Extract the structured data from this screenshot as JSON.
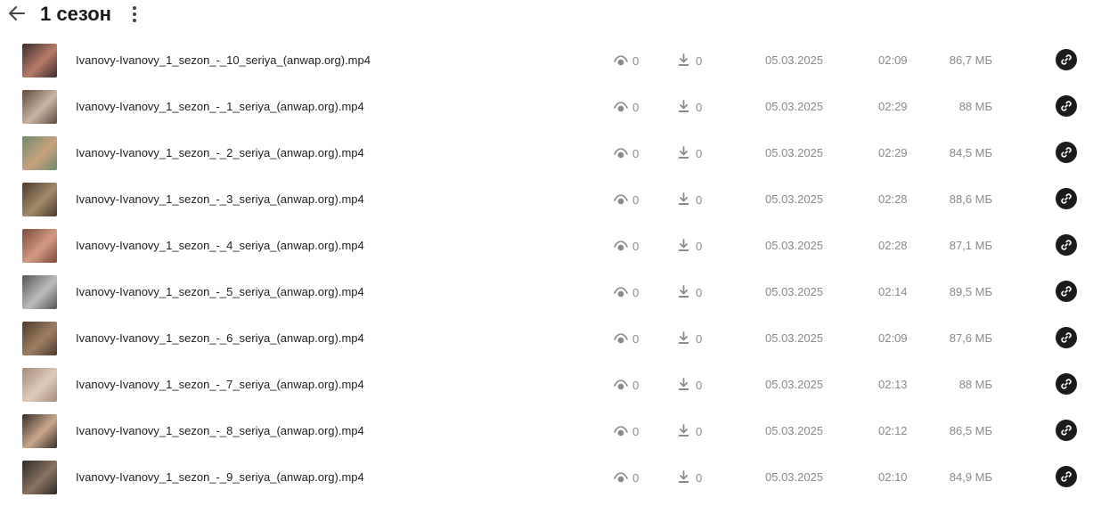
{
  "header": {
    "title": "1 сезон",
    "back_icon": "arrow-left-icon",
    "more_icon": "kebab-menu-icon"
  },
  "colors": {
    "text": "#222222",
    "muted": "#8a8a8a",
    "link_button": "#1c1c1c"
  },
  "files": [
    {
      "name": "Ivanovy-Ivanovy_1_sezon_-_10_seriya_(anwap.org).mp4",
      "views": "0",
      "downloads": "0",
      "date": "05.03.2025",
      "duration": "02:09",
      "size": "86,7 МБ",
      "thumb_colors": [
        "#3b2e2a",
        "#b77b6a"
      ]
    },
    {
      "name": "Ivanovy-Ivanovy_1_sezon_-_1_seriya_(anwap.org).mp4",
      "views": "0",
      "downloads": "0",
      "date": "05.03.2025",
      "duration": "02:29",
      "size": "88 МБ",
      "thumb_colors": [
        "#5a4a3e",
        "#c9b6a3"
      ]
    },
    {
      "name": "Ivanovy-Ivanovy_1_sezon_-_2_seriya_(anwap.org).mp4",
      "views": "0",
      "downloads": "0",
      "date": "05.03.2025",
      "duration": "02:29",
      "size": "84,5 МБ",
      "thumb_colors": [
        "#6e8a6a",
        "#c8a27e"
      ]
    },
    {
      "name": "Ivanovy-Ivanovy_1_sezon_-_3_seriya_(anwap.org).mp4",
      "views": "0",
      "downloads": "0",
      "date": "05.03.2025",
      "duration": "02:28",
      "size": "88,6 МБ",
      "thumb_colors": [
        "#4a3a2c",
        "#a48a6a"
      ]
    },
    {
      "name": "Ivanovy-Ivanovy_1_sezon_-_4_seriya_(anwap.org).mp4",
      "views": "0",
      "downloads": "0",
      "date": "05.03.2025",
      "duration": "02:28",
      "size": "87,1 МБ",
      "thumb_colors": [
        "#7a4a3a",
        "#d39a82"
      ]
    },
    {
      "name": "Ivanovy-Ivanovy_1_sezon_-_5_seriya_(anwap.org).mp4",
      "views": "0",
      "downloads": "0",
      "date": "05.03.2025",
      "duration": "02:14",
      "size": "89,5 МБ",
      "thumb_colors": [
        "#555555",
        "#bdbdbd"
      ]
    },
    {
      "name": "Ivanovy-Ivanovy_1_sezon_-_6_seriya_(anwap.org).mp4",
      "views": "0",
      "downloads": "0",
      "date": "05.03.2025",
      "duration": "02:09",
      "size": "87,6 МБ",
      "thumb_colors": [
        "#4d3b2e",
        "#9e7e62"
      ]
    },
    {
      "name": "Ivanovy-Ivanovy_1_sezon_-_7_seriya_(anwap.org).mp4",
      "views": "0",
      "downloads": "0",
      "date": "05.03.2025",
      "duration": "02:13",
      "size": "88 МБ",
      "thumb_colors": [
        "#a58a78",
        "#e0cbbb"
      ]
    },
    {
      "name": "Ivanovy-Ivanovy_1_sezon_-_8_seriya_(anwap.org).mp4",
      "views": "0",
      "downloads": "0",
      "date": "05.03.2025",
      "duration": "02:12",
      "size": "86,5 МБ",
      "thumb_colors": [
        "#3a2e26",
        "#c9a88c"
      ]
    },
    {
      "name": "Ivanovy-Ivanovy_1_sezon_-_9_seriya_(anwap.org).mp4",
      "views": "0",
      "downloads": "0",
      "date": "05.03.2025",
      "duration": "02:10",
      "size": "84,9 МБ",
      "thumb_colors": [
        "#2e2a26",
        "#8a7262"
      ]
    }
  ]
}
